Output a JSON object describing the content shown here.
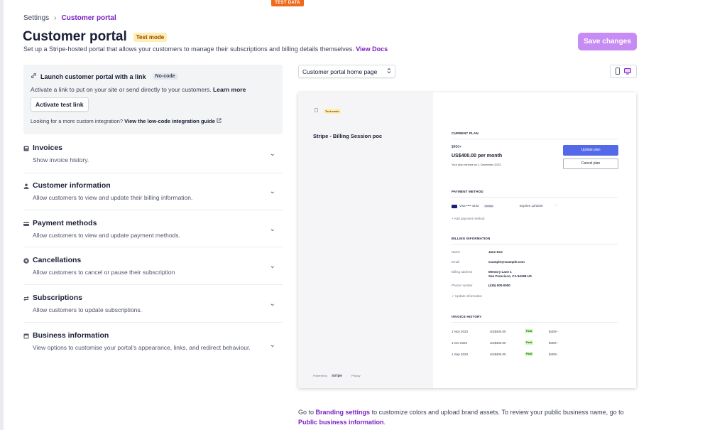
{
  "banner": "TEST DATA",
  "breadcrumb": {
    "parent": "Settings",
    "current": "Customer portal"
  },
  "page": {
    "title": "Customer portal",
    "badge": "Test mode",
    "subtitle": "Set up a Stripe-hosted portal that allows your customers to manage their subscriptions and billing details themselves.",
    "docs_link": "View Docs",
    "save_label": "Save changes"
  },
  "launch": {
    "title": "Launch customer portal with a link",
    "chip": "No-code",
    "text": "Activate a link to put on your site or send directly to your customers.",
    "learn_more": "Learn more",
    "button": "Activate test link",
    "more_text": "Looking for a more custom integration?",
    "more_link": "View the low-code integration guide"
  },
  "sections": [
    {
      "title": "Invoices",
      "desc": "Show invoice history."
    },
    {
      "title": "Customer information",
      "desc": "Allow customers to view and update their billing information."
    },
    {
      "title": "Payment methods",
      "desc": "Allow customers to view and update payment methods."
    },
    {
      "title": "Cancellations",
      "desc": "Allow customers to cancel or pause their subscription"
    },
    {
      "title": "Subscriptions",
      "desc": "Allow customers to update subscriptions."
    },
    {
      "title": "Business information",
      "desc": "View options to customise your portal's appearance, links, and redirect behaviour."
    }
  ],
  "preview_select": "Customer portal home page",
  "preview": {
    "test_mode": "Test mode",
    "merchant": "Stripe - Billing Session poc",
    "powered_by": "Powered by",
    "stripe": "stripe",
    "privacy": "Privacy",
    "current_plan": {
      "label": "CURRENT PLAN",
      "plan": "$400+",
      "price": "US$400.00 per month",
      "renews": "Your plan renews on 1 December 2023.",
      "update": "Update plan",
      "cancel": "Cancel plan"
    },
    "payment": {
      "label": "PAYMENT METHOD",
      "card": "Visa •••• 4242",
      "default": "Default",
      "expires": "Expires 12/2026",
      "more": "···",
      "add": "+ Add payment method"
    },
    "billing": {
      "label": "BILLING INFORMATION",
      "name_label": "Name",
      "name": "Jane Doe",
      "email_label": "Email",
      "email": "example@example.com",
      "address_label": "Billing address",
      "address1": "Memory Lane 1",
      "address2": "San Francisco, CA 94158 US",
      "phone_label": "Phone number",
      "phone": "(415) 000-0000",
      "update": "✓ Update information"
    },
    "invoices": {
      "label": "INVOICE HISTORY",
      "rows": [
        {
          "date": "1 Nov 2023",
          "amount": "US$400.00",
          "status": "Paid",
          "plan": "$400+"
        },
        {
          "date": "1 Oct 2023",
          "amount": "US$400.00",
          "status": "Paid",
          "plan": "$400+"
        },
        {
          "date": "1 Sep 2023",
          "amount": "US$400.00",
          "status": "Paid",
          "plan": "$400+"
        }
      ]
    }
  },
  "footer": {
    "pre": "Go to",
    "branding": "Branding settings",
    "mid": "to customize colors and upload brand assets. To review your public business name, go to",
    "public": "Public business information",
    "end": "."
  },
  "colors": {
    "accent": "#7a1fc1",
    "save_button": "#c78cf4",
    "update_plan": "#5369e8"
  }
}
